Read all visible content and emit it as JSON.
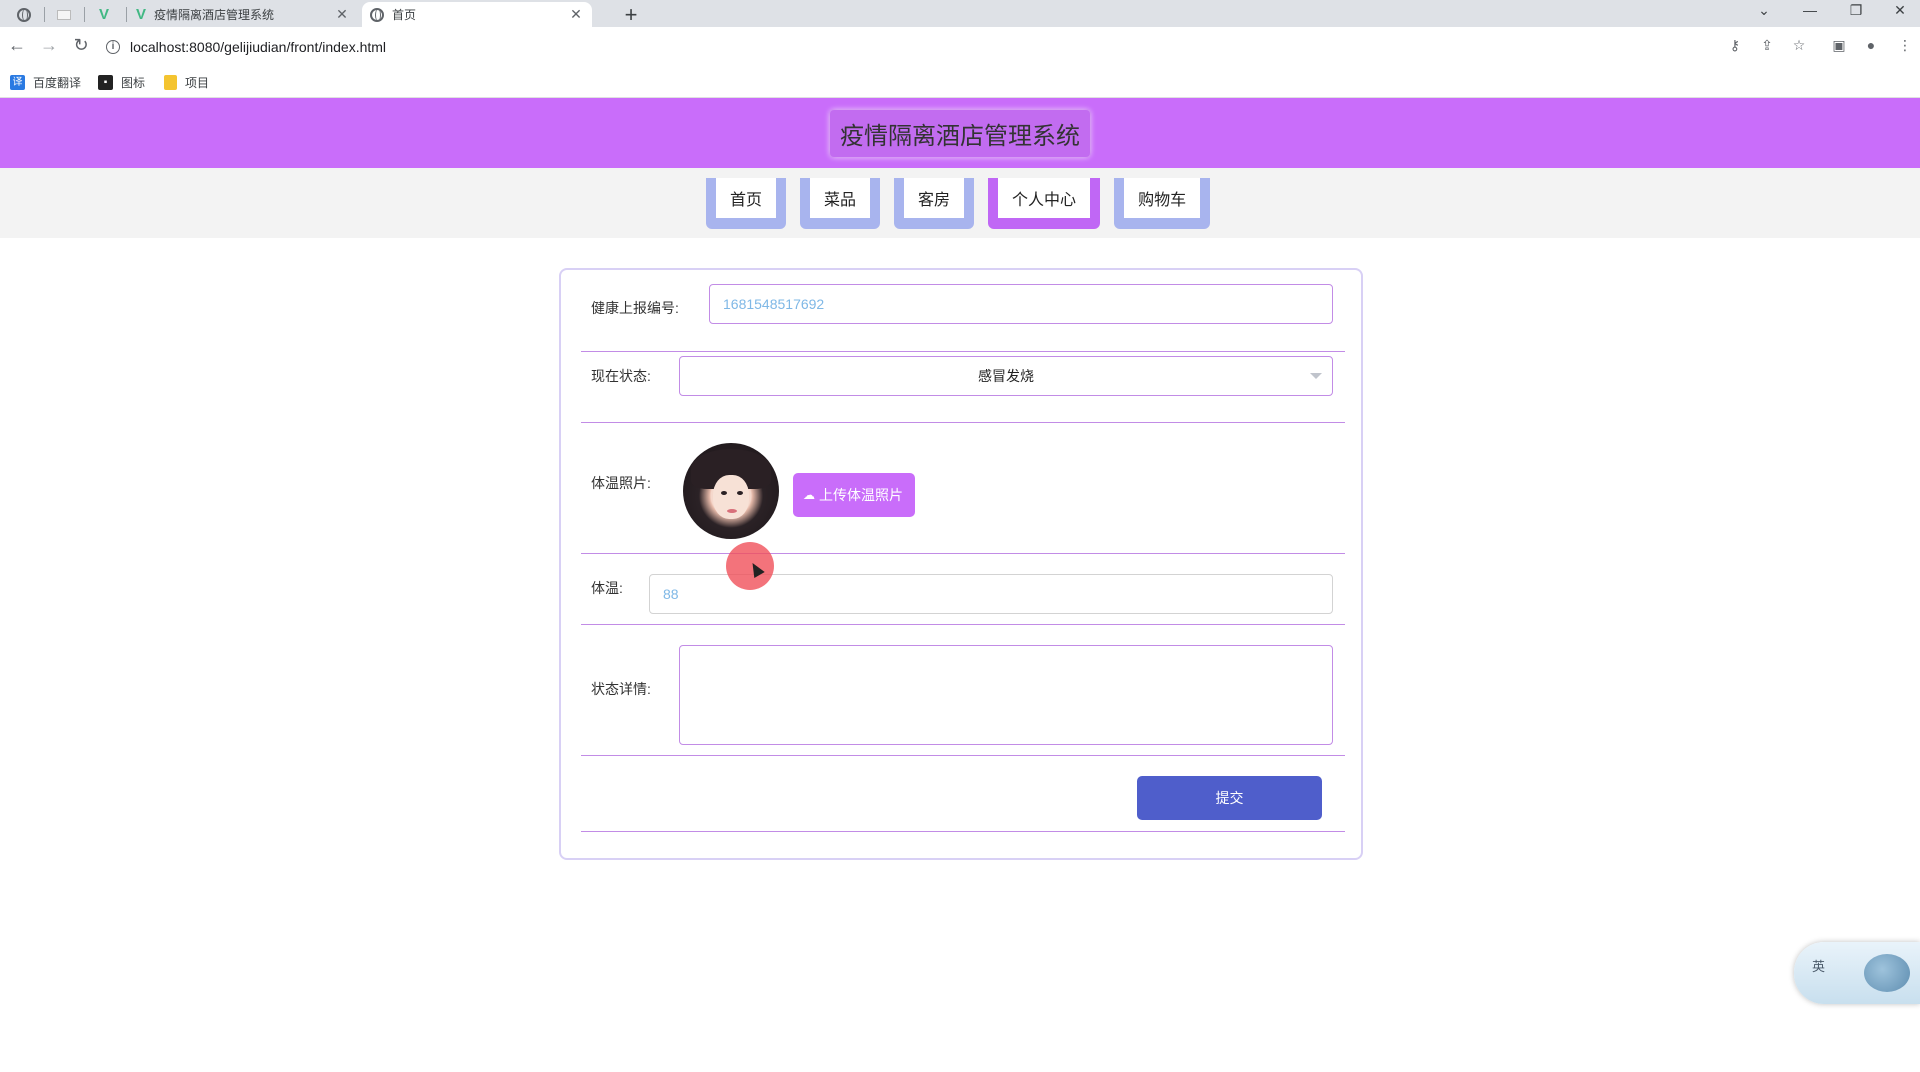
{
  "browser": {
    "tabs": [
      {
        "title": "",
        "icon": "globe-icon",
        "pinned": true
      },
      {
        "title": "",
        "icon": "blank-page-icon",
        "pinned": true
      },
      {
        "title": "",
        "icon": "vue-icon",
        "pinned": true
      },
      {
        "title": "疫情隔离酒店管理系统",
        "icon": "vue-icon",
        "close": "✕"
      },
      {
        "title": "首页",
        "icon": "globe-icon",
        "close": "✕"
      }
    ],
    "newtab": "+",
    "url": "localhost:8080/gelijiudian/front/index.html",
    "bookmarks": [
      {
        "label": "百度翻译",
        "icon": "translate-icon",
        "color": "#2a7ae2"
      },
      {
        "label": "图标",
        "icon": "picture-icon",
        "color": "#222222"
      },
      {
        "label": "项目",
        "icon": "folder-icon",
        "color": "#f4c430"
      }
    ]
  },
  "header": {
    "title": "疫情隔离酒店管理系统"
  },
  "nav": {
    "items": [
      {
        "label": "首页",
        "active": false
      },
      {
        "label": "菜品",
        "active": false
      },
      {
        "label": "客房",
        "active": false
      },
      {
        "label": "个人中心",
        "active": true
      },
      {
        "label": "购物车",
        "active": false
      }
    ]
  },
  "form": {
    "report_id": {
      "label": "健康上报编号:",
      "value": "1681548517692"
    },
    "status": {
      "label": "现在状态:",
      "value": "感冒发烧"
    },
    "photo": {
      "label": "体温照片:",
      "upload_label": "上传体温照片"
    },
    "temperature": {
      "label": "体温:",
      "value": "88"
    },
    "details": {
      "label": "状态详情:",
      "value": ""
    },
    "submit_label": "提交"
  },
  "widget": {
    "label": "英"
  },
  "colors": {
    "header_bg": "#c96dfa",
    "nav_active": "#c067f5",
    "nav_inactive": "#a8b4ee",
    "submit_bg": "#4f5ecb",
    "input_border": "#c28ce6"
  }
}
